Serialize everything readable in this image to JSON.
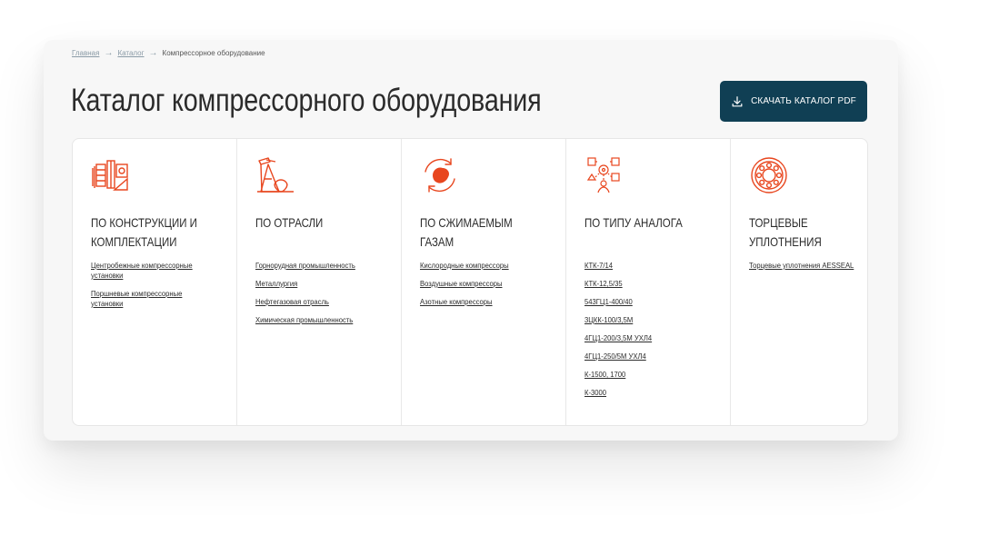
{
  "breadcrumb": {
    "home": "Главная",
    "catalog": "Каталог",
    "current": "Компрессорное оборудование",
    "separator": "→"
  },
  "page_title": "Каталог компрессорного оборудования",
  "download_button": {
    "label": "СКАЧАТЬ КАТАЛОГ PDF",
    "icon": "download-icon"
  },
  "accent_color": "#e8461e",
  "button_color": "#103f54",
  "categories": [
    {
      "icon": "blueprint-equipment-icon",
      "title": "ПО КОНСТРУКЦИИ И КОМПЛЕКТАЦИИ",
      "links": [
        "Центробежные компрессорные установки",
        "Поршневые компрессорные установки"
      ]
    },
    {
      "icon": "oil-pump-jack-icon",
      "title": "ПО ОТРАСЛИ",
      "links": [
        "Горнорудная промышленность",
        "Металлургия",
        "Нефтегазовая отрасль",
        "Химическая промышленность"
      ]
    },
    {
      "icon": "gas-cycle-icon",
      "title": "ПО СЖИМАЕМЫМ ГАЗАМ",
      "links": [
        "Кислородные компрессоры",
        "Воздушные компрессоры",
        "Азотные компрессоры"
      ]
    },
    {
      "icon": "analog-network-icon",
      "title": "ПО ТИПУ АНАЛОГА",
      "links": [
        "КТК-7/14",
        "КТК-12,5/35",
        "543ГЦ1-400/40",
        "3ЦКК-100/3,5М",
        "4ГЦ1-200/3,5М УХЛ4",
        "4ГЦ1-250/5М УХЛ4",
        "К-1500, 1700",
        "К-3000"
      ]
    },
    {
      "icon": "bearing-seal-icon",
      "title": "ТОРЦЕВЫЕ УПЛОТНЕНИЯ",
      "links": [
        "Торцевые уплотнения AESSEAL"
      ]
    }
  ]
}
